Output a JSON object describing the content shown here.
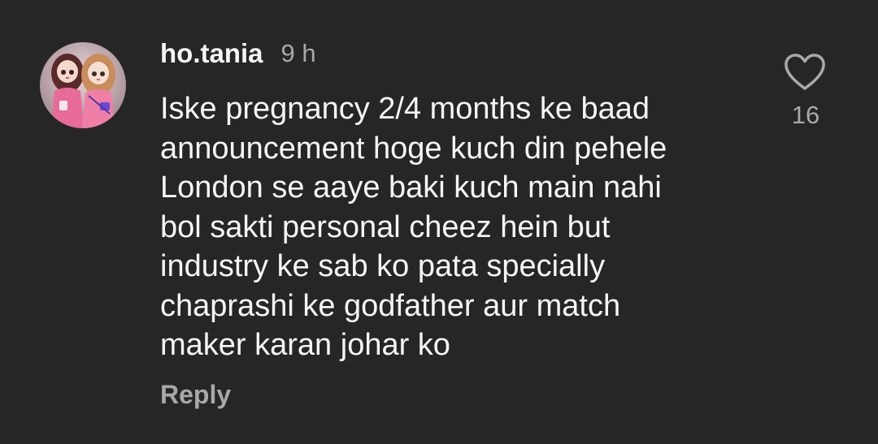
{
  "comment": {
    "username": "ho.tania",
    "time": "9 h",
    "lines": [
      "Iske pregnancy 2/4 months ke baad",
      "announcement hoge kuch din pehele",
      "London se aaye baki kuch main nahi",
      "bol sakti personal cheez hein but",
      "industry ke sab ko pata specially",
      "chaprashi ke godfather aur match",
      "maker karan johar ko"
    ],
    "reply_label": "Reply",
    "like_count": "16",
    "like_icon": "heart-outline-icon"
  },
  "colors": {
    "background": "#262626",
    "primary_text": "#f5f5f5",
    "secondary_text": "#a8a8a8"
  }
}
